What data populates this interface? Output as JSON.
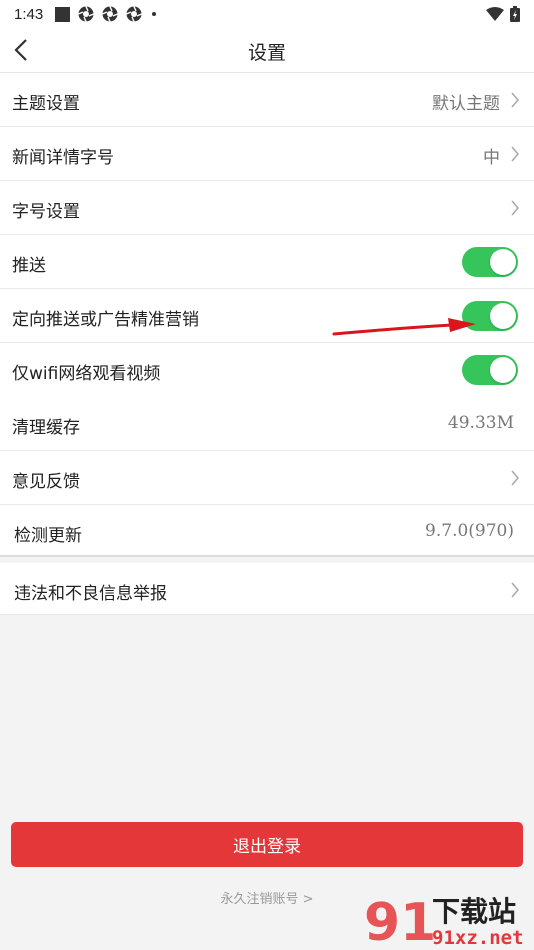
{
  "status_bar": {
    "time": "1:43"
  },
  "nav": {
    "title": "设置"
  },
  "settings": [
    {
      "label": "主题设置",
      "value": "默认主题"
    },
    {
      "label": "新闻详情字号",
      "value": "中"
    },
    {
      "label": "字号设置",
      "value": ""
    },
    {
      "label": "推送",
      "toggle_on": true
    },
    {
      "label": "定向推送或广告精准营销",
      "toggle_on": true
    },
    {
      "label": "仅wifi网络观看视频",
      "toggle_on": true
    }
  ],
  "settings2": [
    {
      "label": "清理缓存",
      "value": "49.33M"
    },
    {
      "label": "意见反馈",
      "value": ""
    },
    {
      "label": "检测更新",
      "value": "9.7.0(970)"
    }
  ],
  "settings3": [
    {
      "label": "违法和不良信息举报"
    }
  ],
  "logout_label": "退出登录",
  "cancel_account_label": "永久注销账号 >",
  "watermark": {
    "number": "91",
    "text_top": "下载站",
    "text_bottom": "91xz.net"
  },
  "colors": {
    "toggle": "#36c55a",
    "logout": "#e3373a",
    "arrow": "#d8161c"
  }
}
